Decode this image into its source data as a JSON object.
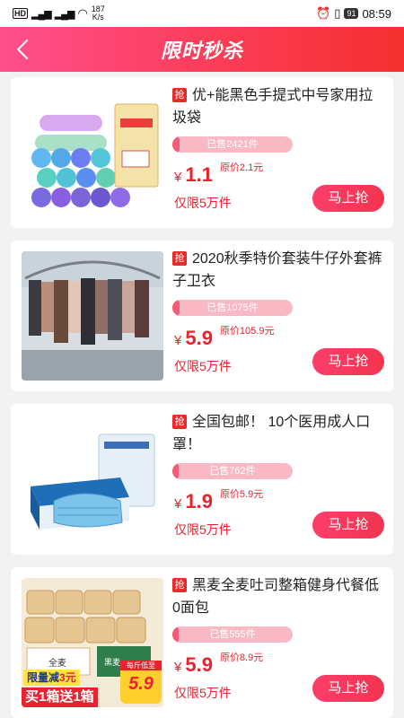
{
  "status": {
    "hd": "HD",
    "signal1": "4G",
    "signal2": "4G",
    "speed_value": "187",
    "speed_unit": "K/s",
    "battery": "91",
    "time": "08:59"
  },
  "header": {
    "title": "限时秒杀",
    "accent_start": "#ff4f8d",
    "accent_end": "#f5302e"
  },
  "products": [
    {
      "tag": "抢",
      "title": "优+能黑色手提式中号家用拉圾袋",
      "sold": "已售2421件",
      "sold_fraction": 0.06,
      "currency": "¥",
      "price": "1.1",
      "original": "原价2.1元",
      "limit": "仅限5万件",
      "button": "马上抢",
      "image": "garbage-bags"
    },
    {
      "tag": "抢",
      "title": "2020秋季特价套装牛仔外套裤子卫衣",
      "sold": "已售1075件",
      "sold_fraction": 0.06,
      "currency": "¥",
      "price": "5.9",
      "original": "原价105.9元",
      "limit": "仅限5万件",
      "button": "马上抢",
      "image": "clothes-rack"
    },
    {
      "tag": "抢",
      "title": "全国包邮！ 10个医用成人口罩！",
      "sold": "已售762件",
      "sold_fraction": 0.05,
      "currency": "¥",
      "price": "1.9",
      "original": "原价5.9元",
      "limit": "仅限5万件",
      "button": "马上抢",
      "image": "face-masks"
    },
    {
      "tag": "抢",
      "title": "黑麦全麦吐司整箱健身代餐低0面包",
      "sold": "已售555件",
      "sold_fraction": 0.05,
      "currency": "¥",
      "price": "5.9",
      "original": "原价8.9元",
      "limit": "仅限5万件",
      "button": "马上抢",
      "image": "bread-box",
      "promo": {
        "line1": "限量减",
        "amount": "3元",
        "line2": "买1箱送1箱",
        "price_note": "每斤低至",
        "price": "5.9"
      }
    }
  ]
}
